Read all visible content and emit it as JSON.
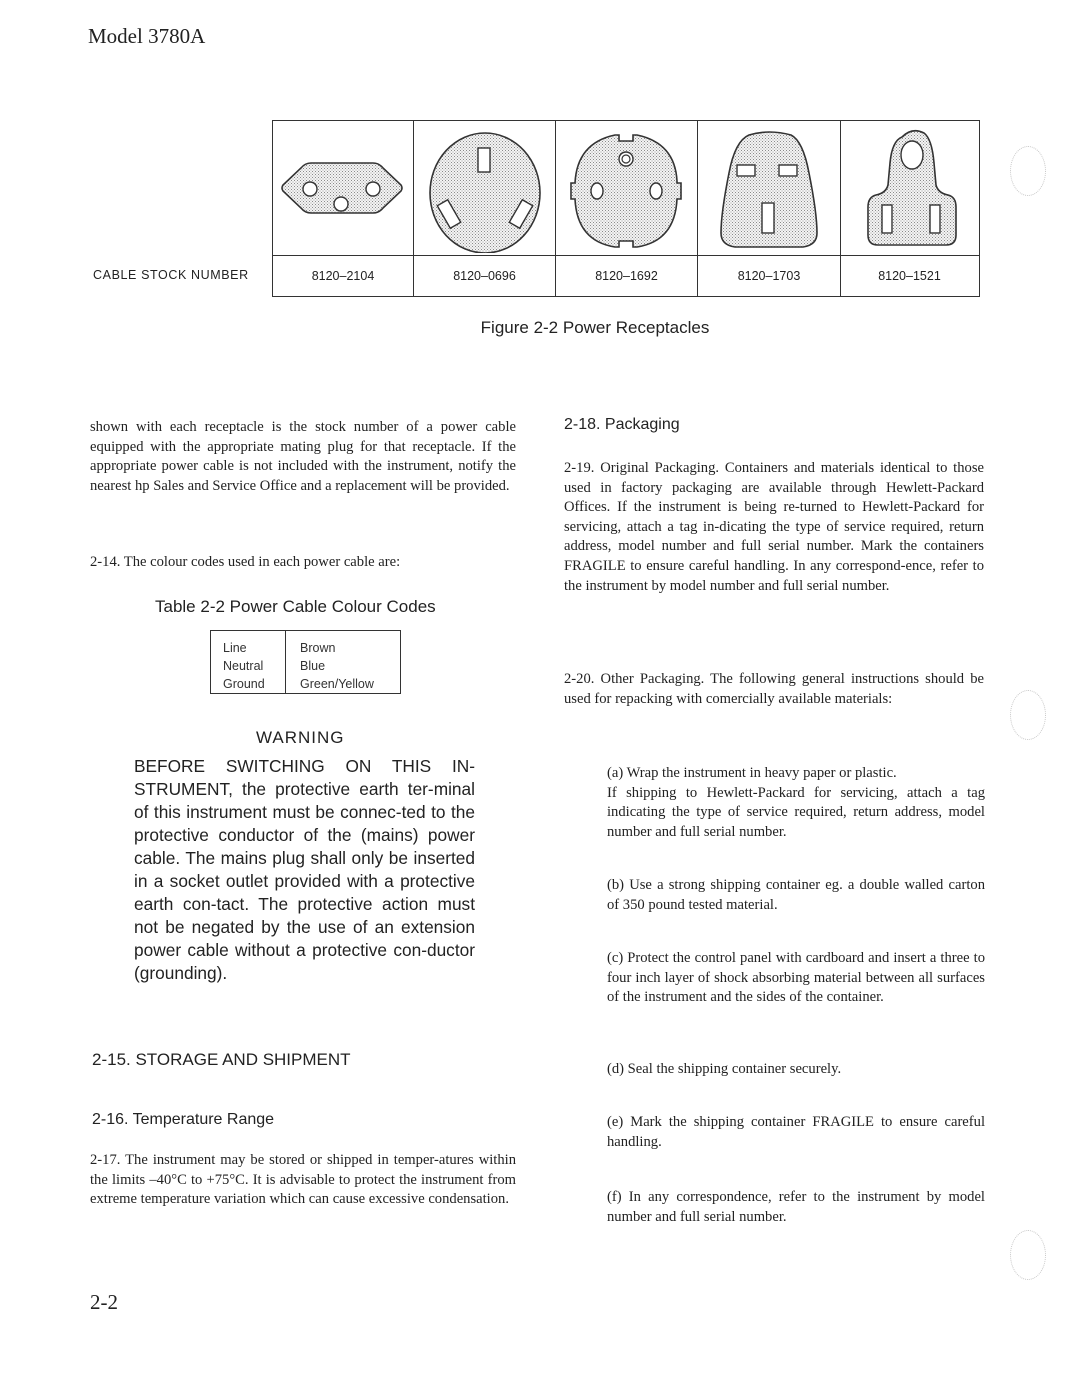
{
  "header": {
    "model": "Model 3780A"
  },
  "figure": {
    "row_label": "CABLE STOCK NUMBER",
    "caption": "Figure 2-2  Power Receptacles",
    "receptacles": [
      {
        "icon": "hexagonal-3-pin-receptacle-icon",
        "stock_number": "8120–2104"
      },
      {
        "icon": "round-3-slot-angled-receptacle-icon",
        "stock_number": "8120–0696"
      },
      {
        "icon": "schuko-receptacle-icon",
        "stock_number": "8120–1692"
      },
      {
        "icon": "uk-3-rectangular-pin-receptacle-icon",
        "stock_number": "8120–1703"
      },
      {
        "icon": "us-3-pin-receptacle-icon",
        "stock_number": "8120–1521"
      }
    ]
  },
  "left_column": {
    "intro": "shown with each receptacle is the stock number of a power cable equipped with the appropriate mating plug for that receptacle. If the appropriate power cable is not included with the instrument, notify the nearest hp Sales and Service Office and a replacement will be provided.",
    "para_214": "2-14. The colour codes used in each power cable are:",
    "table_title": "Table 2-2 Power Cable Colour Codes",
    "colour_codes": [
      {
        "conductor": "Line",
        "colour": "Brown"
      },
      {
        "conductor": "Neutral",
        "colour": "Blue"
      },
      {
        "conductor": "Ground",
        "colour": "Green/Yellow"
      }
    ],
    "warning_title": "WARNING",
    "warning_text": "BEFORE SWITCHING ON THIS IN-STRUMENT, the protective earth ter-minal of this instrument must be connec-ted to the protective conductor of the (mains) power cable. The mains plug shall only be inserted in a socket outlet provided with a protective earth con-tact. The protective action must not be negated by the use of an extension power cable without a protective con-ductor (grounding).",
    "heading_215": "2-15. STORAGE AND SHIPMENT",
    "heading_216": "2-16. Temperature Range",
    "para_217": "2-17. The instrument may be stored or shipped in temper-atures within the limits –40°C to +75°C. It is advisable to protect the instrument from extreme temperature variation which can cause excessive condensation."
  },
  "right_column": {
    "heading_218": "2-18. Packaging",
    "para_219": "2-19. Original Packaging. Containers and materials identical to those used in factory packaging are available through Hewlett-Packard Offices. If the instrument is being re-turned to Hewlett-Packard for servicing, attach a tag in-dicating the type of service required, return address, model number and full serial number. Mark the containers FRAGILE to ensure careful handling. In any correspond-ence, refer to the instrument by model number and full serial number.",
    "para_220": "2-20. Other Packaging. The following general instructions should be used for repacking with comercially available materials:",
    "items": [
      {
        "text": "(a)  Wrap the instrument in heavy paper or plastic.\nIf shipping to Hewlett-Packard for servicing, attach a tag indicating the type of service required, return address, model number and full serial number."
      },
      {
        "text": "(b) Use a strong shipping container eg. a double walled carton of 350 pound tested material."
      },
      {
        "text": "(c) Protect the control panel with cardboard and insert a three to four inch layer of shock absorbing material between all surfaces of the instrument and the sides of the container."
      },
      {
        "text": "(d)  Seal the shipping container securely."
      },
      {
        "text": "(e) Mark the shipping container FRAGILE to ensure careful handling."
      },
      {
        "text": "(f)  In any correspondence, refer to the instrument by model number and full serial number."
      }
    ]
  },
  "footer": {
    "page_number": "2-2"
  }
}
